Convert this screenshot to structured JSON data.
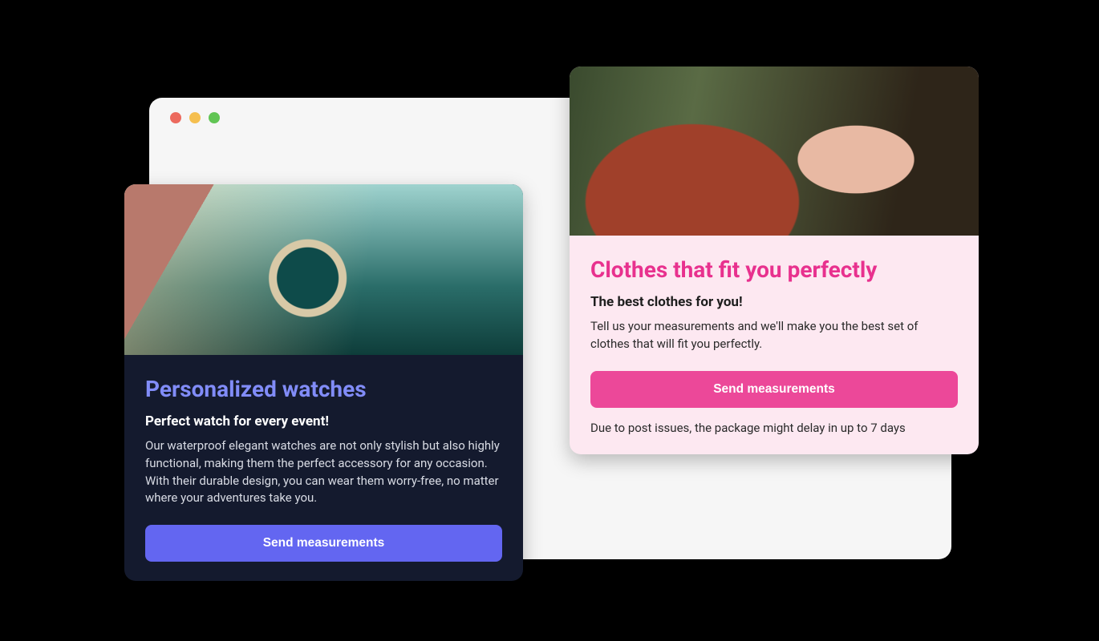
{
  "cards": {
    "watches": {
      "title": "Personalized watches",
      "subtitle": "Perfect watch for every event!",
      "body": "Our waterproof elegant watches are not only stylish but also highly functional, making them the perfect accessory for any occasion. With their durable design, you can wear them worry-free, no matter where your adventures take you.",
      "button_label": "Send measurements"
    },
    "clothes": {
      "title": "Clothes that fit you perfectly",
      "subtitle": "The best clothes for you!",
      "body": "Tell us your measurements and we'll make you the best set of clothes that will fit you perfectly.",
      "button_label": "Send measurements",
      "note": "Due to post issues, the package might delay in up to 7 days"
    }
  },
  "colors": {
    "indigo_accent": "#818cf8",
    "indigo_button": "#6366f1",
    "pink_accent": "#e8318e",
    "pink_button": "#ec4899",
    "dark_card_bg": "#141a2e",
    "light_card_bg": "#fde8f1"
  }
}
